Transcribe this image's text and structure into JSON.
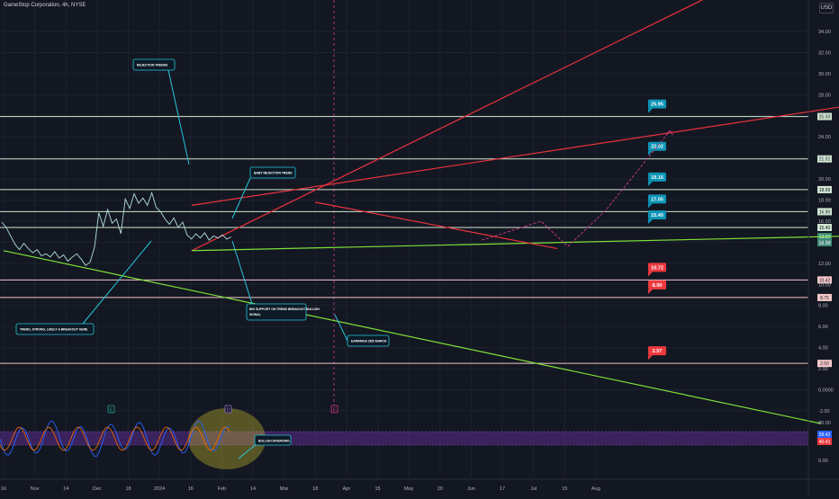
{
  "header": {
    "symbol_title": "GameStop Corporation, 4h, NYSE",
    "currency_label": "USD"
  },
  "colors": {
    "background": "#131722",
    "grid": "#1e2230",
    "price_line": "#b2dfdb",
    "support_line": "#7fe03b",
    "rejection_line": "#e8333c",
    "projection": "#d13b8a",
    "level_line": "#d1e7d1",
    "teal_label": "#0d95b5",
    "red_label": "#ed3a3f",
    "axis_text": "#b2b5be",
    "oscillator_band": "#5b2b8c",
    "highlight_zone": "#d8c72a"
  },
  "chart_data": {
    "type": "line",
    "symbol": "GameStop Corporation",
    "interval": "4h",
    "exchange": "NYSE",
    "currency": "USD",
    "y_axis_ticks": [
      "34.00",
      "32.00",
      "30.00",
      "28.00",
      "26.00",
      "24.00",
      "22.00",
      "20.00",
      "18.00",
      "16.00",
      "14.00",
      "12.00",
      "10.00",
      "8.00",
      "6.00",
      "4.00",
      "2.00",
      "0.0000",
      "-2.00"
    ],
    "x_axis_ticks": [
      "16",
      "Nov",
      "14",
      "Dec",
      "18",
      "2024",
      "16",
      "Feb",
      "14",
      "Mar",
      "18",
      "Apr",
      "15",
      "May",
      "20",
      "Jun",
      "17",
      "Jul",
      "15",
      "Aug"
    ],
    "price_series": [
      {
        "x": 0,
        "y": 15.9
      },
      {
        "x": 1,
        "y": 15.4
      },
      {
        "x": 2,
        "y": 14.6
      },
      {
        "x": 3,
        "y": 13.8
      },
      {
        "x": 4,
        "y": 13.3
      },
      {
        "x": 5,
        "y": 13.9
      },
      {
        "x": 6,
        "y": 13.4
      },
      {
        "x": 7,
        "y": 13.0
      },
      {
        "x": 8,
        "y": 13.3
      },
      {
        "x": 9,
        "y": 12.7
      },
      {
        "x": 10,
        "y": 12.9
      },
      {
        "x": 11,
        "y": 12.6
      },
      {
        "x": 12,
        "y": 13.1
      },
      {
        "x": 13,
        "y": 12.5
      },
      {
        "x": 14,
        "y": 12.8
      },
      {
        "x": 15,
        "y": 12.2
      },
      {
        "x": 16,
        "y": 12.6
      },
      {
        "x": 17,
        "y": 12.9
      },
      {
        "x": 18,
        "y": 12.4
      },
      {
        "x": 19,
        "y": 11.8
      },
      {
        "x": 20,
        "y": 12.1
      },
      {
        "x": 21,
        "y": 13.5
      },
      {
        "x": 22,
        "y": 16.8
      },
      {
        "x": 23,
        "y": 15.5
      },
      {
        "x": 24,
        "y": 17.1
      },
      {
        "x": 25,
        "y": 15.8
      },
      {
        "x": 26,
        "y": 16.2
      },
      {
        "x": 27,
        "y": 14.8
      },
      {
        "x": 28,
        "y": 18.1
      },
      {
        "x": 29,
        "y": 17.2
      },
      {
        "x": 30,
        "y": 18.6
      },
      {
        "x": 31,
        "y": 17.7
      },
      {
        "x": 32,
        "y": 18.2
      },
      {
        "x": 33,
        "y": 17.5
      },
      {
        "x": 34,
        "y": 18.7
      },
      {
        "x": 35,
        "y": 17.3
      },
      {
        "x": 36,
        "y": 16.9
      },
      {
        "x": 37,
        "y": 16.2
      },
      {
        "x": 38,
        "y": 15.7
      },
      {
        "x": 39,
        "y": 16.3
      },
      {
        "x": 40,
        "y": 15.4
      },
      {
        "x": 41,
        "y": 15.9
      },
      {
        "x": 42,
        "y": 14.7
      },
      {
        "x": 43,
        "y": 14.3
      },
      {
        "x": 44,
        "y": 14.8
      },
      {
        "x": 45,
        "y": 14.4
      },
      {
        "x": 46,
        "y": 14.9
      },
      {
        "x": 47,
        "y": 14.2
      },
      {
        "x": 48,
        "y": 14.6
      },
      {
        "x": 49,
        "y": 14.4
      },
      {
        "x": 50,
        "y": 14.7
      },
      {
        "x": 51,
        "y": 14.3
      },
      {
        "x": 52,
        "y": 14.5
      }
    ],
    "horizontal_levels": [
      {
        "label": "25.95",
        "axis_label": "25.93",
        "value": 25.93,
        "color": "teal"
      },
      {
        "label": "22.02",
        "axis_label": "21.91",
        "value": 21.91,
        "color": "teal"
      },
      {
        "label": "19.16",
        "axis_label": "18.99",
        "value": 18.99,
        "color": "teal"
      },
      {
        "label": "17.05",
        "axis_label": "16.90",
        "value": 16.9,
        "color": "teal"
      },
      {
        "label": "15.40",
        "axis_label": "15.40",
        "value": 15.4,
        "color": "teal"
      },
      {
        "label": "10.72",
        "axis_label": "10.42",
        "value": 10.42,
        "color": "red"
      },
      {
        "label": "8.90",
        "axis_label": "8.75",
        "value": 8.75,
        "color": "red"
      },
      {
        "label": "2.57",
        "axis_label": "2.50",
        "value": 2.5,
        "color": "red"
      }
    ],
    "current_price_labels": [
      "13.89",
      "12.19"
    ],
    "trend_lines": [
      {
        "name": "rejection-upper",
        "color": "red",
        "points": [
          [
            3.5,
            17.5
          ],
          [
            30,
            38
          ]
        ]
      },
      {
        "name": "rejection-steep",
        "color": "red",
        "points": [
          [
            3.5,
            13.2
          ],
          [
            14.2,
            40
          ]
        ]
      },
      {
        "name": "support-rising",
        "color": "green",
        "points": [
          [
            3.5,
            13.2
          ],
          [
            30,
            16.2
          ]
        ]
      },
      {
        "name": "downtrend",
        "color": "green",
        "points": [
          [
            0,
            13.2
          ],
          [
            15.2,
            -3.2
          ]
        ]
      },
      {
        "name": "rejection-baby",
        "color": "red",
        "points": [
          [
            5.8,
            17.8
          ],
          [
            10.3,
            13.4
          ]
        ]
      }
    ],
    "projection_path": [
      [
        8.9,
        14.2
      ],
      [
        10.0,
        16.0
      ],
      [
        10.5,
        13.6
      ],
      [
        11.2,
        17.0
      ],
      [
        12.4,
        24.6
      ]
    ],
    "annotations": [
      "REJECTION TRENDS",
      "BABY REJECTION TREND",
      "TREND, STRONG, LIKELY A BREAKOUT HERE",
      "BIG SUPPORT ON TREND BREAKOUT BULLISH SIGNAL",
      "EARNINGS 28th MARCH"
    ],
    "event_markers": [
      "E",
      "D",
      "E"
    ],
    "oscillator": {
      "label": "BULLISH DIVERGING",
      "ticks": [
        "80.00",
        "40.00",
        "0.00"
      ],
      "values": [
        "59.42",
        "40.41"
      ]
    },
    "ylim": [
      -3.6,
      37.0
    ]
  }
}
